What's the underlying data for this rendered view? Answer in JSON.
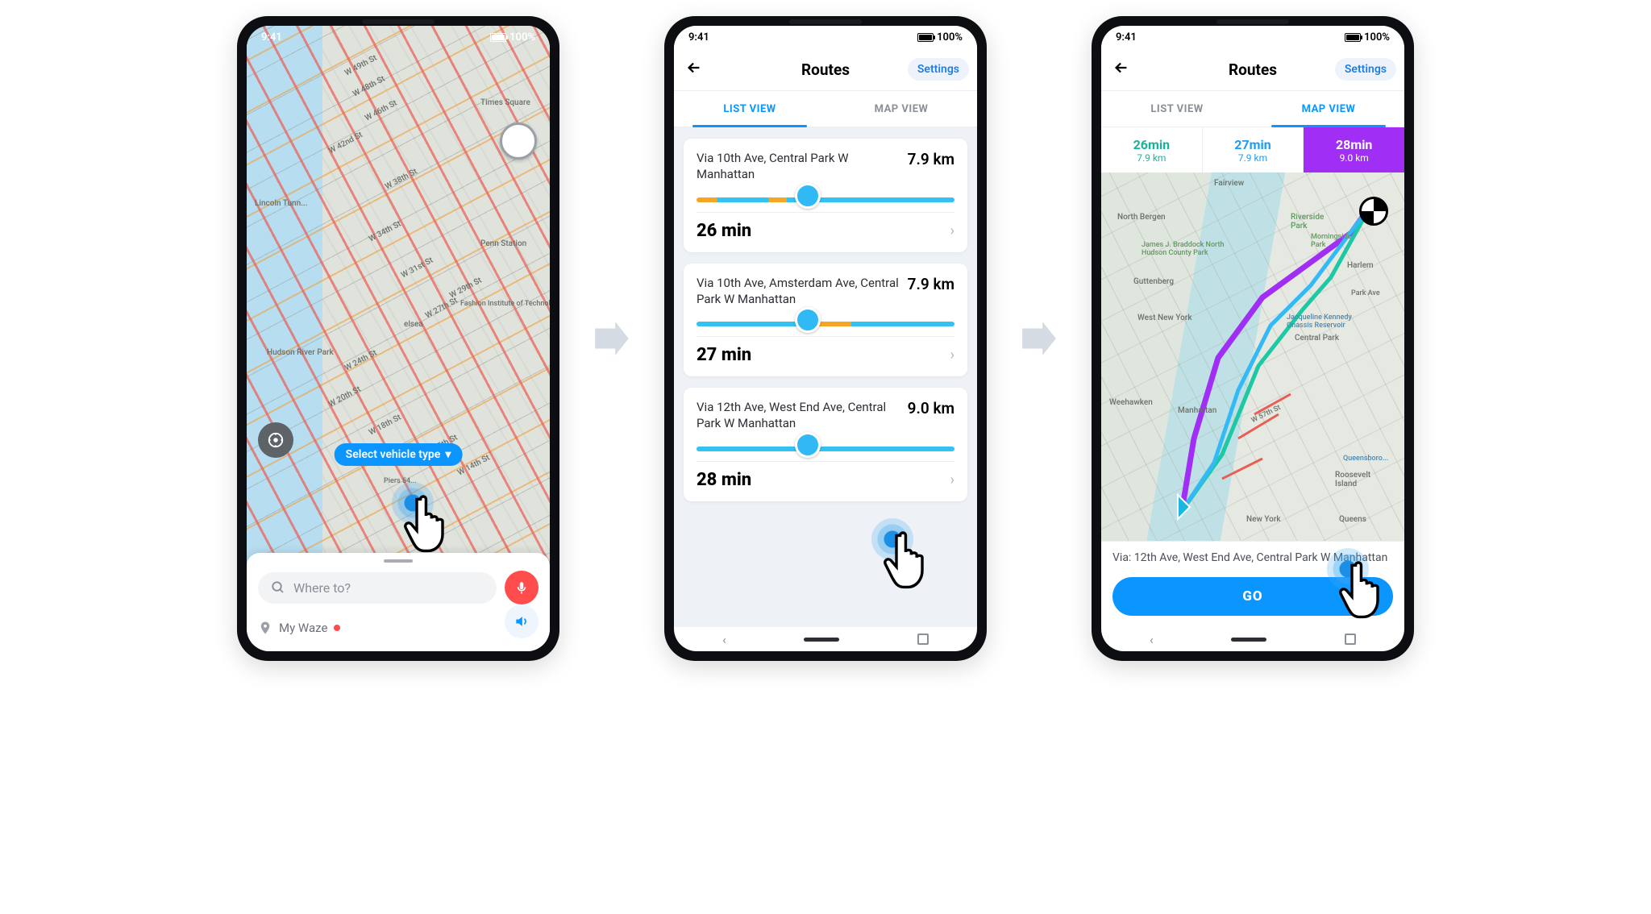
{
  "status": {
    "time": "9:41",
    "battery": "100%"
  },
  "screen1": {
    "select_vehicle": "Select vehicle type",
    "search_placeholder": "Where to?",
    "my_waze": "My Waze",
    "streets": [
      "W 49th St",
      "W 48th St",
      "W 46th St",
      "W 42nd St",
      "W 38th St",
      "W 34th St",
      "W 31st St",
      "W 29th St",
      "W 27th St",
      "W 24th St",
      "W 20th St",
      "W 18th St",
      "W 15th St",
      "W 14th St"
    ],
    "places": [
      "Times Square",
      "Lincoln Tunn...",
      "Hudson River Park",
      "Penn Station",
      "Fashion Institute of Technology",
      "elsea",
      "Piers 54..."
    ]
  },
  "screen2": {
    "title": "Routes",
    "settings": "Settings",
    "tab_list": "LIST VIEW",
    "tab_map": "MAP VIEW",
    "routes": [
      {
        "via": "Via 10th Ave, Central Park W Manhattan",
        "dist": "7.9 km",
        "time": "26 min"
      },
      {
        "via": "Via 10th Ave, Amsterdam Ave, Central Park W Manhattan",
        "dist": "7.9 km",
        "time": "27 min"
      },
      {
        "via": "Via 12th Ave, West End Ave, Central Park W Manhattan",
        "dist": "9.0 km",
        "time": "28 min"
      }
    ]
  },
  "screen3": {
    "title": "Routes",
    "settings": "Settings",
    "tab_list": "LIST VIEW",
    "tab_map": "MAP VIEW",
    "options": [
      {
        "t": "26min",
        "d": "7.9 km"
      },
      {
        "t": "27min",
        "d": "7.9 km"
      },
      {
        "t": "28min",
        "d": "9.0 km"
      }
    ],
    "map_labels": [
      "North Bergen",
      "Guttenberg",
      "West New York",
      "Weehawken",
      "Manhattan",
      "New York",
      "Queens",
      "Roosevelt Island",
      "Central Park",
      "Fairview",
      "Riverside Park",
      "Morningside Park",
      "Harlem",
      "Park Ave",
      "James J. Braddock North Hudson County Park",
      "Jacqueline Kennedy Onassis Reservoir",
      "W 57th St",
      "Queensboro..."
    ],
    "via": "Via: 12th Ave, West End Ave, Central Park W Manhattan",
    "go": "GO"
  }
}
